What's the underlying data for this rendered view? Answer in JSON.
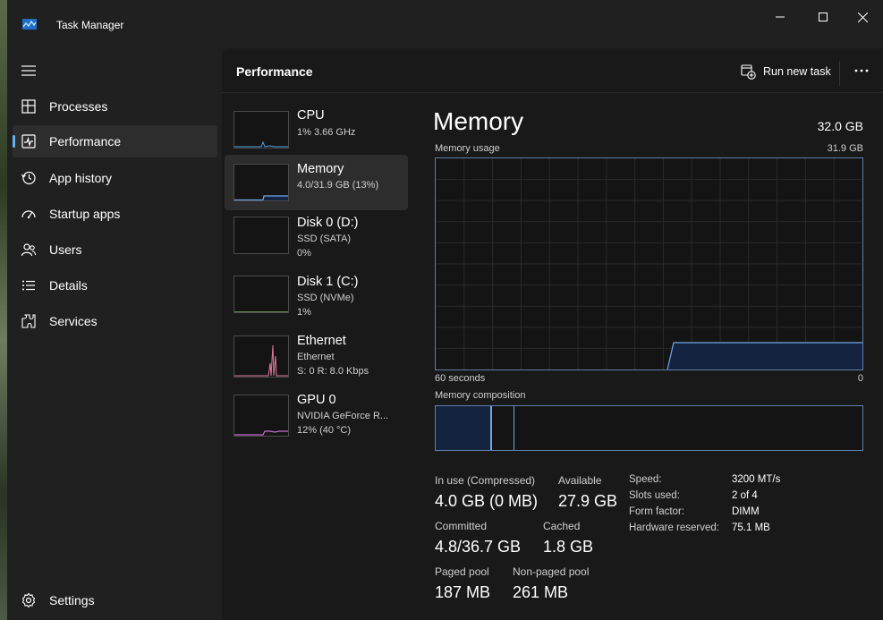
{
  "window": {
    "title": "Task Manager",
    "controls": {
      "minimize": "–",
      "maximize": "☐",
      "close": "✕"
    }
  },
  "sidebar": {
    "items": [
      {
        "label": "Processes",
        "icon": "processes-icon"
      },
      {
        "label": "Performance",
        "icon": "performance-icon",
        "active": true
      },
      {
        "label": "App history",
        "icon": "history-icon"
      },
      {
        "label": "Startup apps",
        "icon": "startup-icon"
      },
      {
        "label": "Users",
        "icon": "users-icon"
      },
      {
        "label": "Details",
        "icon": "details-icon"
      },
      {
        "label": "Services",
        "icon": "services-icon"
      }
    ],
    "settings": {
      "label": "Settings",
      "icon": "gear-icon"
    }
  },
  "header": {
    "title": "Performance",
    "run_new_task": "Run new task"
  },
  "devices": [
    {
      "name": "CPU",
      "lines": [
        "1% 3.66 GHz"
      ]
    },
    {
      "name": "Memory",
      "lines": [
        "4.0/31.9 GB (13%)"
      ],
      "active": true
    },
    {
      "name": "Disk 0 (D:)",
      "lines": [
        "SSD (SATA)",
        "0%"
      ]
    },
    {
      "name": "Disk 1 (C:)",
      "lines": [
        "SSD (NVMe)",
        "1%"
      ]
    },
    {
      "name": "Ethernet",
      "lines": [
        "Ethernet",
        "S: 0 R: 8.0 Kbps"
      ]
    },
    {
      "name": "GPU 0",
      "lines": [
        "NVIDIA GeForce R...",
        "12% (40 °C)"
      ]
    }
  ],
  "memory": {
    "title": "Memory",
    "total": "32.0 GB",
    "usage_label": "Memory usage",
    "usage_max": "31.9 GB",
    "time_start": "60 seconds",
    "time_end": "0",
    "composition_label": "Memory composition",
    "stats": {
      "in_use_label": "In use (Compressed)",
      "in_use": "4.0 GB (0 MB)",
      "available_label": "Available",
      "available": "27.9 GB",
      "committed_label": "Committed",
      "committed": "4.8/36.7 GB",
      "cached_label": "Cached",
      "cached": "1.8 GB",
      "paged_label": "Paged pool",
      "paged": "187 MB",
      "nonpaged_label": "Non-paged pool",
      "nonpaged": "261 MB"
    },
    "properties": {
      "speed_label": "Speed:",
      "speed": "3200 MT/s",
      "slots_label": "Slots used:",
      "slots": "2 of 4",
      "form_label": "Form factor:",
      "form": "DIMM",
      "reserved_label": "Hardware reserved:",
      "reserved": "75.1 MB"
    }
  },
  "colors": {
    "accent": "#5fb2f2",
    "memory_line": "#6fa6ea",
    "memory_fill": "#14233f",
    "graph_border": "#5f7fa8",
    "ethernet": "#e07aa0",
    "gpu": "#c66bd1"
  }
}
